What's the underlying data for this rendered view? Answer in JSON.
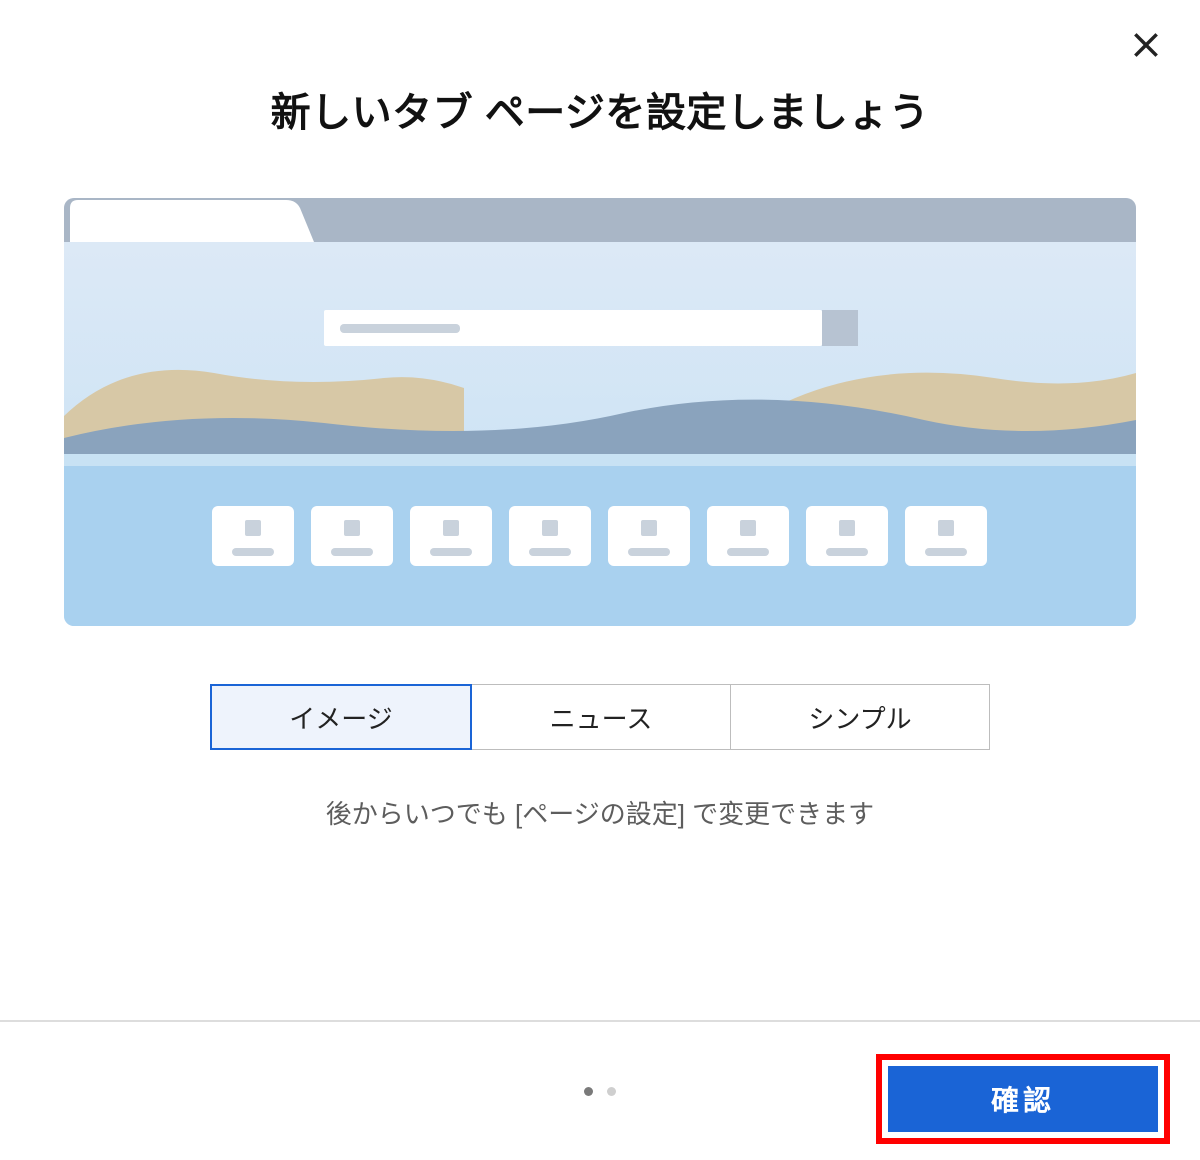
{
  "title": "新しいタブ ページを設定しましょう",
  "segmented": {
    "options": [
      "イメージ",
      "ニュース",
      "シンプル"
    ],
    "selected_index": 0
  },
  "hint": "後からいつでも [ページの設定] で変更できます",
  "pager": {
    "count": 2,
    "active_index": 0
  },
  "confirm_label": "確認",
  "icons": {
    "close": "close-icon"
  },
  "colors": {
    "primary": "#1a64d6",
    "highlight_border": "#ff0000",
    "selected_bg": "#eef3fc"
  }
}
